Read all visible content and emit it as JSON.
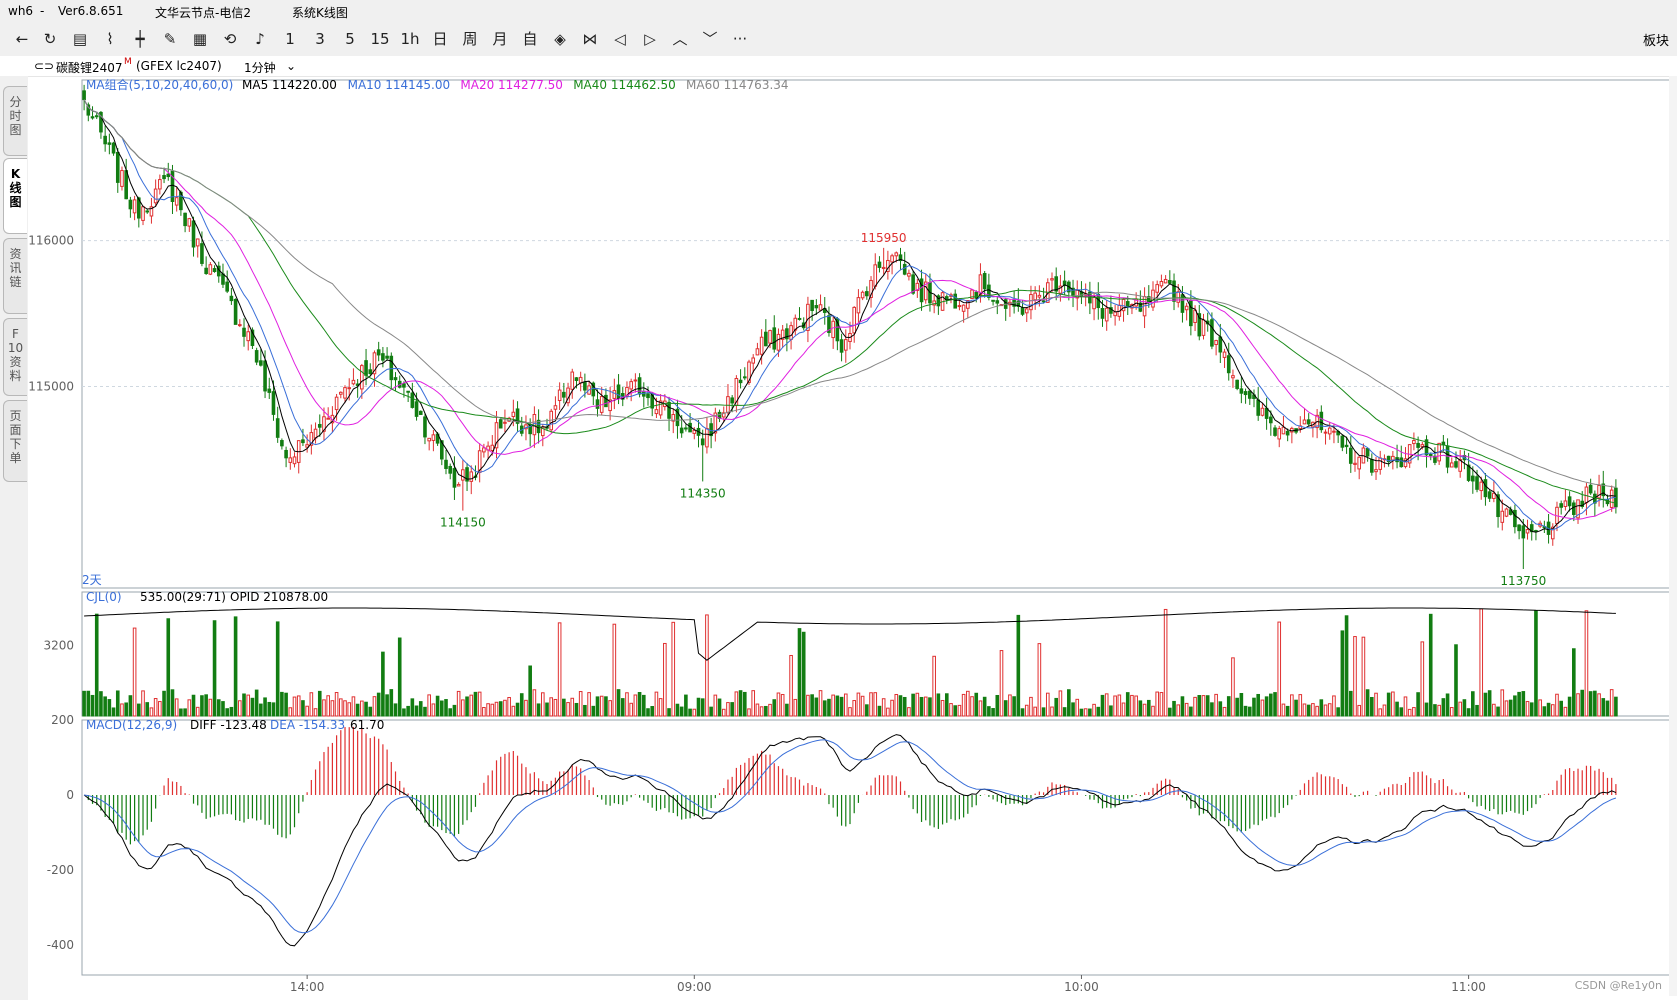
{
  "window": {
    "app": "wh6",
    "sep": "-",
    "version": "Ver6.8.651",
    "server": "文华云节点-电信2",
    "view": "系统K线图"
  },
  "toolbar": {
    "buttons": [
      {
        "name": "back-icon",
        "glyph": "←"
      },
      {
        "name": "refresh-icon",
        "glyph": "↻"
      },
      {
        "name": "list-icon",
        "glyph": "▤"
      },
      {
        "name": "line-chart-icon",
        "glyph": "⌇"
      },
      {
        "name": "candle-icon",
        "glyph": "┿"
      },
      {
        "name": "draw-icon",
        "glyph": "✎"
      },
      {
        "name": "grid-icon",
        "glyph": "▦"
      },
      {
        "name": "sync-icon",
        "glyph": "⟲"
      },
      {
        "name": "bell-icon",
        "glyph": "♪"
      },
      {
        "name": "period-1",
        "glyph": "1"
      },
      {
        "name": "period-3",
        "glyph": "3"
      },
      {
        "name": "period-5",
        "glyph": "5"
      },
      {
        "name": "period-15",
        "glyph": "15"
      },
      {
        "name": "period-1h",
        "glyph": "1h"
      },
      {
        "name": "period-day",
        "glyph": "日"
      },
      {
        "name": "period-week",
        "glyph": "周"
      },
      {
        "name": "period-month",
        "glyph": "月"
      },
      {
        "name": "period-custom",
        "glyph": "自"
      },
      {
        "name": "zoom-icon",
        "glyph": "◈"
      },
      {
        "name": "compress-icon",
        "glyph": "⋈"
      },
      {
        "name": "left-icon",
        "glyph": "◁"
      },
      {
        "name": "right-icon",
        "glyph": "▷"
      },
      {
        "name": "up-icon",
        "glyph": "︿"
      },
      {
        "name": "down-icon",
        "glyph": "﹀"
      },
      {
        "name": "more-icon",
        "glyph": "···"
      }
    ],
    "right_label": "板块"
  },
  "symbol": {
    "icon": "⊂⊃",
    "name": "碳酸锂2407",
    "mark": "M",
    "code": "(GFEX lc2407)",
    "period": "1分钟",
    "caret": "⌄"
  },
  "tabs": [
    {
      "label": "分\n时\n图",
      "active": false
    },
    {
      "label": "K\n线\n图",
      "active": true
    },
    {
      "label": "资\n讯\n链",
      "active": false
    },
    {
      "label": "F\n10\n资\n料",
      "active": false
    },
    {
      "label": "页\n面\n下\n单",
      "active": false
    }
  ],
  "main_legend": {
    "group": "MA组合(5,10,20,40,60,0)",
    "items": [
      {
        "label": "MA5 114220.00",
        "color": "#000000"
      },
      {
        "label": "MA10 114145.00",
        "color": "#3a6fd8"
      },
      {
        "label": "MA20 114277.50",
        "color": "#e020e0"
      },
      {
        "label": "MA40 114462.50",
        "color": "#1a8a1a"
      },
      {
        "label": "MA60 114763.34",
        "color": "#888888"
      }
    ]
  },
  "vol_legend": {
    "group": "CJL(0)",
    "value": "535.00(29:71)",
    "opid": "OPID 210878.00"
  },
  "macd_legend": {
    "group": "MACD(12,26,9)",
    "diff": "DIFF -123.48",
    "dea": "DEA -154.33",
    "macd": "61.70"
  },
  "marker_2d": "2天",
  "watermark": "CSDN @Re1y0n",
  "colors": {
    "up": "#e03030",
    "down": "#127d12",
    "ma5": "#000000",
    "ma10": "#3a6fd8",
    "ma20": "#e020e0",
    "ma40": "#1a8a1a",
    "ma60": "#888888",
    "grid": "#cfd8e0",
    "axis": "#606060"
  },
  "chart_data": {
    "type": "candlestick",
    "price_ylim": [
      113620,
      117100
    ],
    "price_ticks": [
      116000,
      115000
    ],
    "price_tick_labels": [
      "116000",
      "115000"
    ],
    "vol_tick": 3200,
    "vol_tick_label": "3200",
    "vol_max": 5000,
    "macd_ylim": [
      -480,
      200
    ],
    "macd_ticks": [
      200,
      0,
      -200,
      -400
    ],
    "macd_tick_labels": [
      "200",
      "0",
      "-200",
      "-400"
    ],
    "time_labels": [
      {
        "index": 53,
        "label": "14:00"
      },
      {
        "index": 145,
        "label": "09:00"
      },
      {
        "index": 237,
        "label": "10:00"
      },
      {
        "index": 329,
        "label": "11:00"
      }
    ],
    "annotations": [
      {
        "index": 90,
        "value": 114150,
        "label": "114150",
        "kind": "low"
      },
      {
        "index": 147,
        "value": 114350,
        "label": "114350",
        "kind": "low"
      },
      {
        "index": 190,
        "value": 115950,
        "label": "115950",
        "kind": "high"
      },
      {
        "index": 342,
        "value": 113750,
        "label": "113750",
        "kind": "low"
      }
    ],
    "count": 365,
    "keypoints": [
      [
        0,
        116950
      ],
      [
        6,
        116600
      ],
      [
        12,
        116200
      ],
      [
        20,
        116400
      ],
      [
        28,
        115900
      ],
      [
        40,
        115300
      ],
      [
        48,
        114500
      ],
      [
        54,
        114650
      ],
      [
        62,
        115000
      ],
      [
        70,
        115200
      ],
      [
        78,
        114900
      ],
      [
        88,
        114350
      ],
      [
        92,
        114400
      ],
      [
        100,
        114800
      ],
      [
        110,
        114700
      ],
      [
        116,
        115100
      ],
      [
        122,
        114850
      ],
      [
        132,
        115000
      ],
      [
        140,
        114800
      ],
      [
        146,
        114600
      ],
      [
        152,
        114850
      ],
      [
        160,
        115250
      ],
      [
        168,
        115400
      ],
      [
        174,
        115550
      ],
      [
        180,
        115300
      ],
      [
        186,
        115700
      ],
      [
        192,
        115950
      ],
      [
        198,
        115650
      ],
      [
        206,
        115600
      ],
      [
        214,
        115700
      ],
      [
        220,
        115500
      ],
      [
        226,
        115600
      ],
      [
        232,
        115750
      ],
      [
        238,
        115580
      ],
      [
        244,
        115500
      ],
      [
        252,
        115550
      ],
      [
        258,
        115700
      ],
      [
        264,
        115450
      ],
      [
        270,
        115300
      ],
      [
        276,
        114900
      ],
      [
        284,
        114700
      ],
      [
        290,
        114800
      ],
      [
        300,
        114550
      ],
      [
        310,
        114450
      ],
      [
        316,
        114600
      ],
      [
        322,
        114550
      ],
      [
        330,
        114400
      ],
      [
        336,
        114150
      ],
      [
        342,
        113950
      ],
      [
        348,
        114050
      ],
      [
        354,
        114180
      ],
      [
        358,
        114250
      ],
      [
        364,
        114250
      ]
    ],
    "series_names": [
      "MA5",
      "MA10",
      "MA20",
      "MA40",
      "MA60"
    ]
  }
}
